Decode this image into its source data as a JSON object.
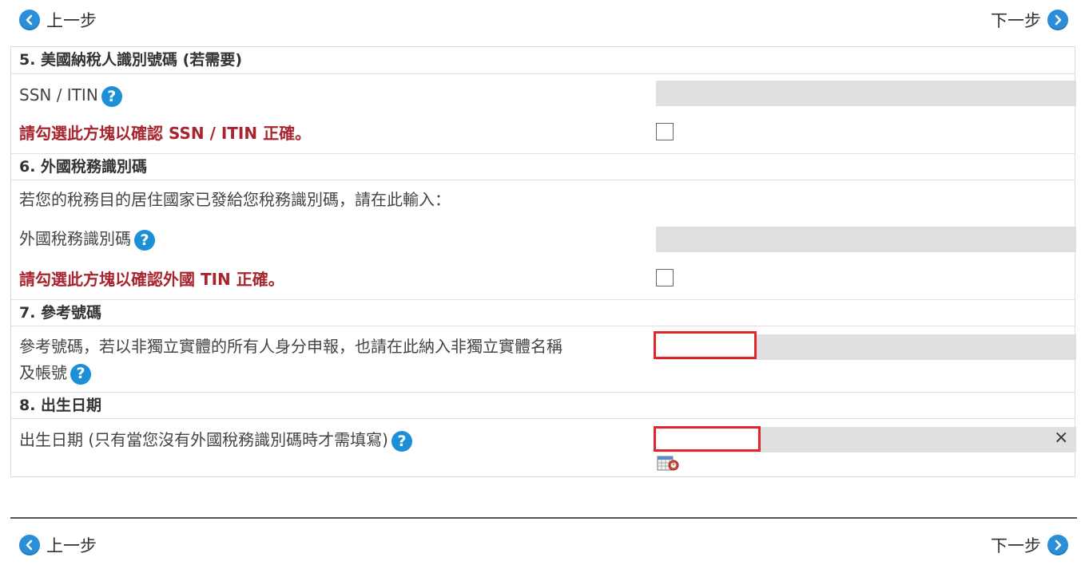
{
  "nav": {
    "prev_label": "上一步",
    "next_label": "下一步"
  },
  "sections": {
    "s5_title": "5. 美國納稅人識別號碼 (若需要)",
    "ssn_label": "SSN / ITIN",
    "ssn_confirm": "請勾選此方塊以確認 SSN / ITIN 正確。",
    "s6_title": "6. 外國稅務識別碼",
    "s6_intro": "若您的稅務目的居住國家已發給您稅務識別碼，請在此輸入：",
    "ftin_label": "外國稅務識別碼",
    "ftin_confirm": "請勾選此方塊以確認外國 TIN 正確。",
    "s7_title": "7. 參考號碼",
    "ref_label_line1": "參考號碼，若以非獨立實體的所有人身分申報，也請在此納入非獨立實體名稱",
    "ref_label_line2": "及帳號",
    "s8_title": "8. 出生日期",
    "dob_label": "出生日期 (只有當您沒有外國稅務識別碼時才需填寫)"
  },
  "icons": {
    "help_glyph": "?",
    "clear_glyph": "×"
  },
  "colors": {
    "accent_blue": "#2a8ed8",
    "warning_red": "#a8242e",
    "highlight_red": "#e0252b"
  }
}
